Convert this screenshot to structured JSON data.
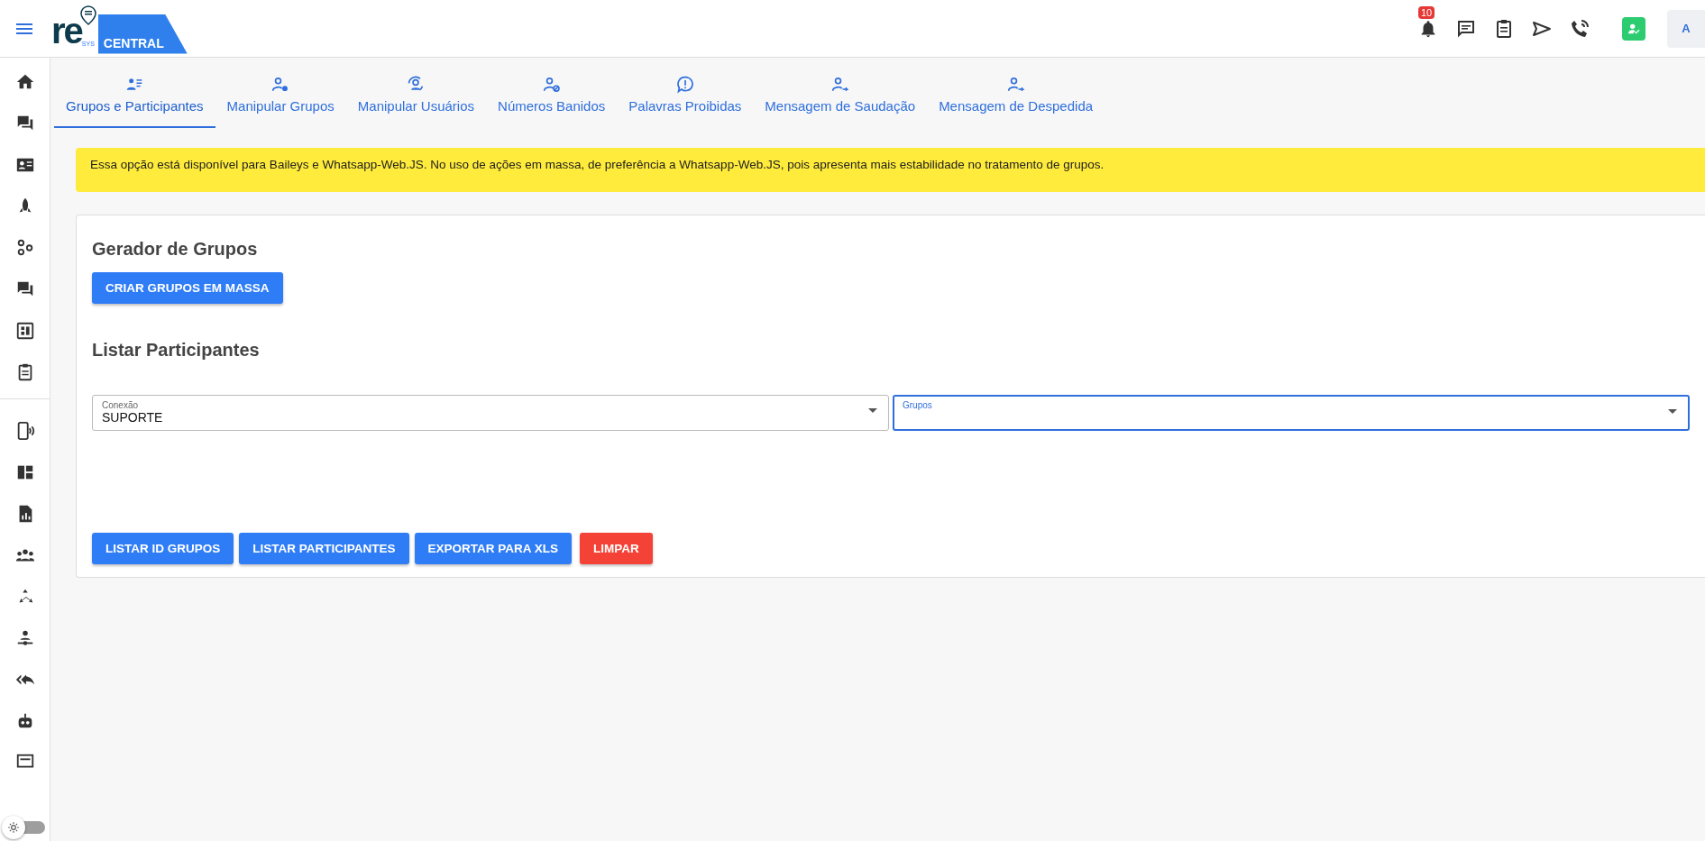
{
  "header": {
    "logo": {
      "word": "re",
      "sub": "SYS",
      "banner": "CENTRAL"
    },
    "notification_badge": "10",
    "avatar": "A"
  },
  "tabs": [
    {
      "label": "Grupos e Participantes",
      "selected": true
    },
    {
      "label": "Manipular Grupos",
      "selected": false
    },
    {
      "label": "Manipular Usuários",
      "selected": false
    },
    {
      "label": "Números Banidos",
      "selected": false
    },
    {
      "label": "Palavras Proibidas",
      "selected": false
    },
    {
      "label": "Mensagem de Saudação",
      "selected": false
    },
    {
      "label": "Mensagem de Despedida",
      "selected": false
    }
  ],
  "notice": "Essa opção está disponível para Baileys e Whatsapp-Web.JS. No uso de ações em massa, de preferência a Whatsapp-Web.JS, pois apresenta mais estabilidade no tratamento de grupos.",
  "generator": {
    "title": "Gerador de Grupos",
    "button": "CRIAR GRUPOS EM MASSA"
  },
  "participants": {
    "title": "Listar Participantes",
    "fields": [
      {
        "label": "Conexão",
        "value": "SUPORTE",
        "focused": false
      },
      {
        "label": "Grupos",
        "focused": true
      }
    ],
    "buttons": [
      {
        "label": "LISTAR ID GRUPOS",
        "kind": "primary"
      },
      {
        "label": "LISTAR PARTICIPANTES",
        "kind": "primary"
      },
      {
        "label": "EXPORTAR PARA XLS",
        "kind": "primary"
      },
      {
        "label": "LIMPAR",
        "kind": "danger"
      }
    ]
  }
}
